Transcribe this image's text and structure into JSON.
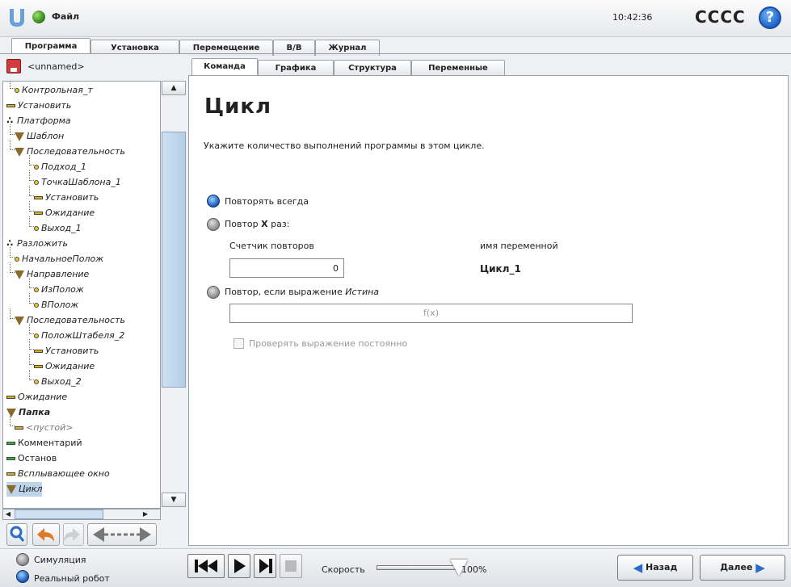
{
  "header": {
    "file_menu": "Файл",
    "clock": "10:42:36",
    "robot_name": "CCCC",
    "help_symbol": "?",
    "logo_icon": "ur-logo-icon",
    "status_icon": "globe-icon"
  },
  "main_tabs": [
    "Программа",
    "Установка",
    "Перемещение",
    "В/В",
    "Журнал"
  ],
  "sub_tabs": [
    "Команда",
    "Графика",
    "Структура",
    "Переменные"
  ],
  "program": {
    "name": "<unnamed>"
  },
  "tree": [
    {
      "label": "Контрольная_т",
      "icon": "waypoint"
    },
    {
      "label": "Установить",
      "icon": "set"
    },
    {
      "label": "Платформа",
      "icon": "cluster"
    },
    {
      "label": "Шаблон",
      "icon": "folder"
    },
    {
      "label": "Последовательность",
      "icon": "folder"
    },
    {
      "label": "Подход_1",
      "icon": "waypoint"
    },
    {
      "label": "ТочкаШаблона_1",
      "icon": "waypoint"
    },
    {
      "label": "Установить",
      "icon": "set"
    },
    {
      "label": "Ожидание",
      "icon": "wait"
    },
    {
      "label": "Выход_1",
      "icon": "waypoint"
    },
    {
      "label": "Разложить",
      "icon": "cluster"
    },
    {
      "label": "НачальноеПолож",
      "icon": "waypoint"
    },
    {
      "label": "Направление",
      "icon": "folder"
    },
    {
      "label": "ИзПолож",
      "icon": "waypoint"
    },
    {
      "label": "ВПолож",
      "icon": "waypoint"
    },
    {
      "label": "Последовательность",
      "icon": "folder"
    },
    {
      "label": "ПоложШтабеля_2",
      "icon": "waypoint"
    },
    {
      "label": "Установить",
      "icon": "set"
    },
    {
      "label": "Ожидание",
      "icon": "wait"
    },
    {
      "label": "Выход_2",
      "icon": "waypoint"
    },
    {
      "label": "Ожидание",
      "icon": "wait"
    },
    {
      "label": "Папка",
      "icon": "folder"
    },
    {
      "label": "<пустой>",
      "icon": "wait"
    },
    {
      "label": "Комментарий",
      "icon": "comment"
    },
    {
      "label": "Останов",
      "icon": "comment"
    },
    {
      "label": "Всплывающее окно",
      "icon": "wait"
    },
    {
      "label": "Цикл",
      "icon": "folder"
    }
  ],
  "command": {
    "title": "Цикл",
    "description": "Укажите количество выполнений программы в этом цикле.",
    "option_always": "Повторять всегда",
    "option_times_prefix": "Повтор ",
    "option_times_x": "X",
    "option_times_suffix": " раз:",
    "counter_label": "Счетчик повторов",
    "varname_label": "имя переменной",
    "counter_value": "0",
    "varname_value": "Цикл_1",
    "option_expr_prefix": "Повтор, если выражение ",
    "option_expr_italic": "Истина",
    "expr_placeholder": "f(x)",
    "check_label": "Проверять выражение постоянно"
  },
  "footer": {
    "simulation_label": "Симуляция",
    "real_robot_label": "Реальный робот",
    "speed_label": "Скорость",
    "speed_value": "100%",
    "speed_fraction": 1.0,
    "back_label": "Назад",
    "next_label": "Далее"
  }
}
